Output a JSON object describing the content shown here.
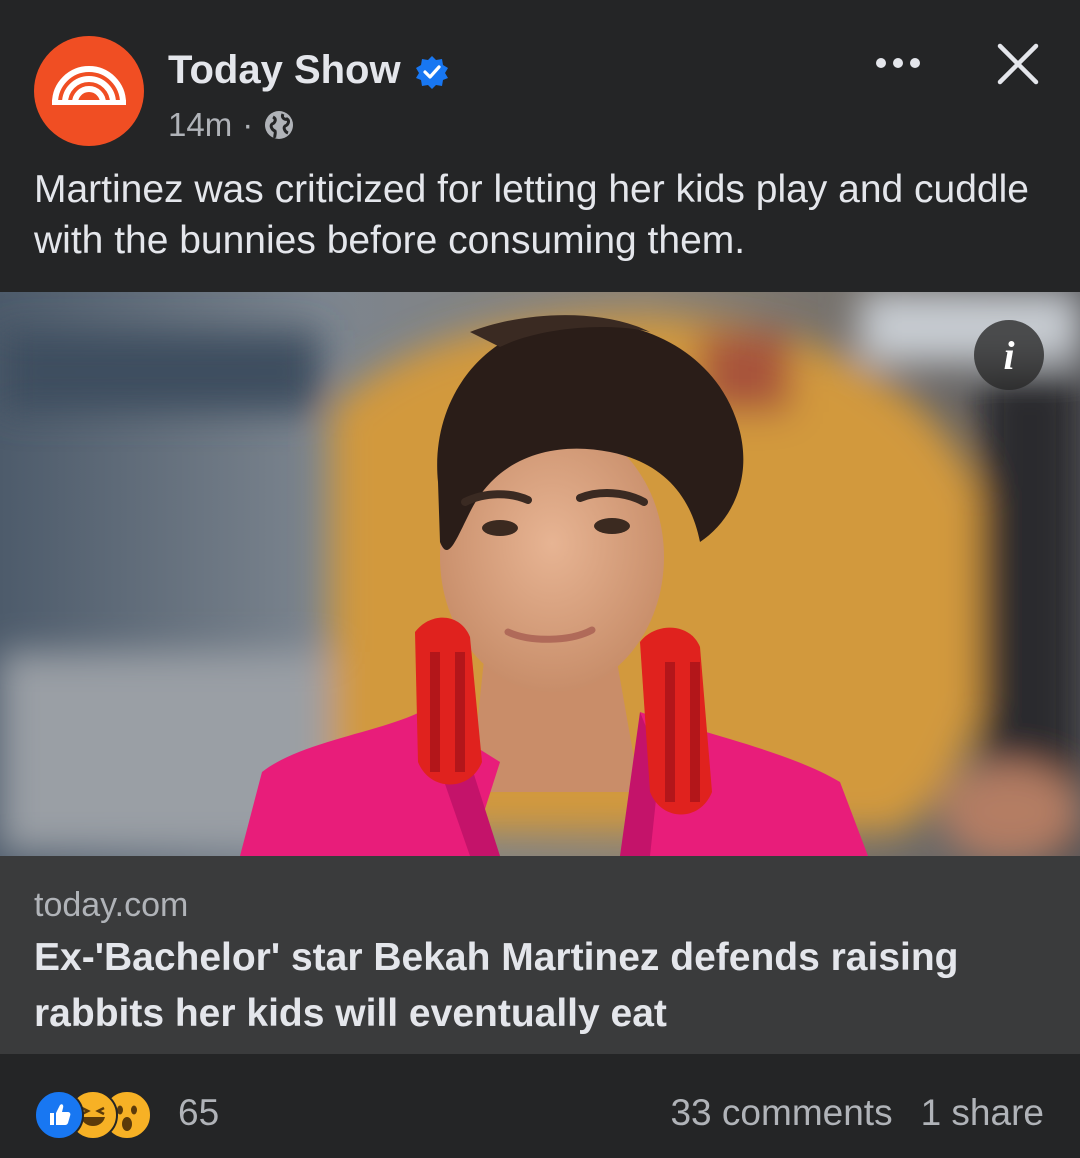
{
  "post": {
    "page_name": "Today Show",
    "timestamp": "14m",
    "separator": "·",
    "privacy_icon": "globe-icon",
    "verified_icon": "verified-badge-icon",
    "more_icon": "more-options-icon",
    "close_icon": "close-icon",
    "caption": "Martinez was criticized for letting her kids play and cuddle with the bunnies before consuming them."
  },
  "link_preview": {
    "info_glyph": "i",
    "domain": "today.com",
    "headline": "Ex-'Bachelor' star Bekah Martinez defends raising rabbits her kids will eventually eat"
  },
  "engagement": {
    "reactions": [
      "like-icon",
      "haha-icon",
      "wow-icon"
    ],
    "reaction_count": "65",
    "comments": "33 comments",
    "shares": "1 share"
  },
  "colors": {
    "background": "#242526",
    "link_card": "#3a3b3c",
    "brand": "#f04e23",
    "verified": "#1877f2",
    "text": "#e4e6eb",
    "muted": "#b0b3b8"
  }
}
